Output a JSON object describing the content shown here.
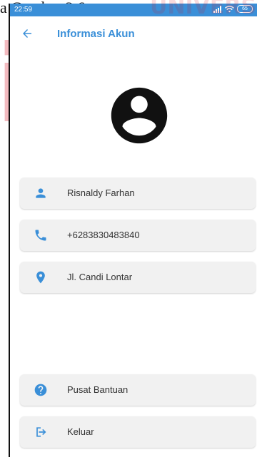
{
  "document": {
    "caption_fragment": "a Gambar 3.6.",
    "watermark_top": "UNIVERSI",
    "watermark_big": "inan"
  },
  "status_bar": {
    "time": "22:59",
    "battery": "65",
    "color": "#3a8fd8"
  },
  "app_bar": {
    "title": "Informasi Akun",
    "back_icon": "arrow-left-icon",
    "accent_color": "#3a8fd8"
  },
  "profile": {
    "avatar_icon": "account-circle-icon"
  },
  "info_items": [
    {
      "icon": "person-icon",
      "label": "Risnaldy Farhan"
    },
    {
      "icon": "phone-icon",
      "label": "+6283830483840"
    },
    {
      "icon": "location-pin-icon",
      "label": "Jl. Candi Lontar"
    }
  ],
  "actions": [
    {
      "icon": "help-circle-icon",
      "label": "Pusat Bantuan"
    },
    {
      "icon": "logout-icon",
      "label": "Keluar"
    }
  ]
}
